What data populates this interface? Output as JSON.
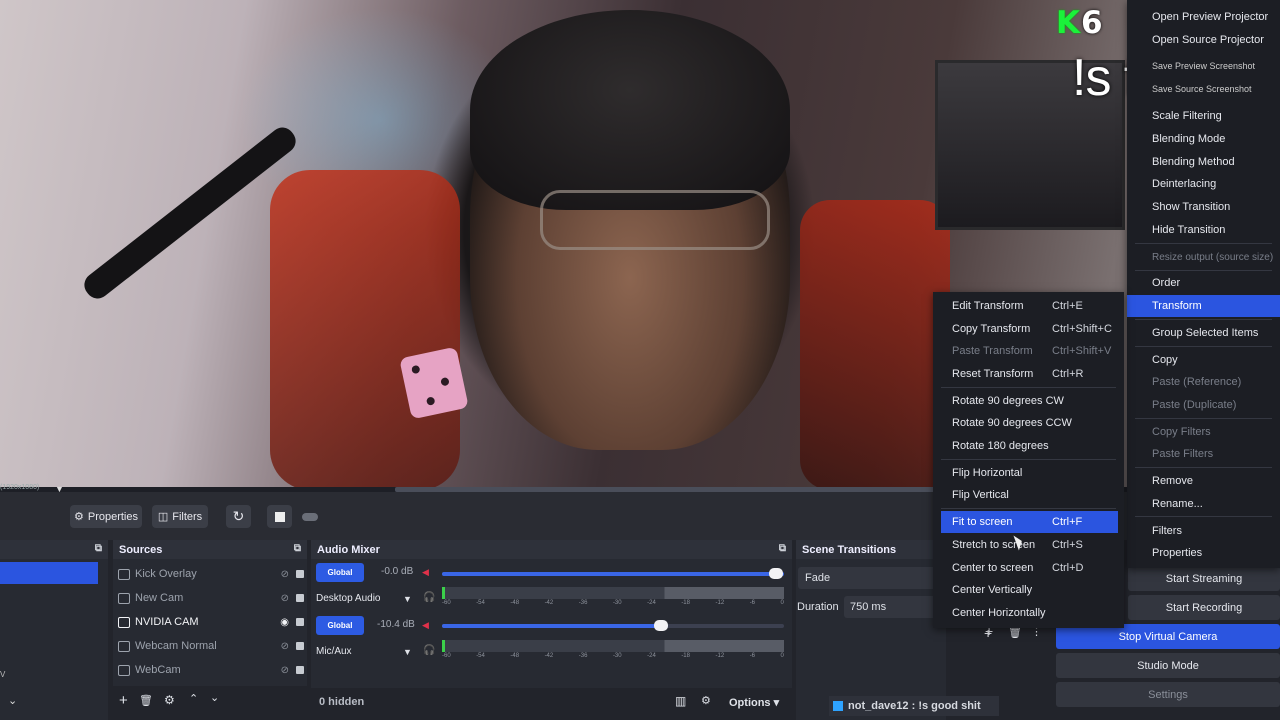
{
  "overlay": {
    "k_logo": "K",
    "k_number": "6",
    "tts_text": "!s for tts",
    "resolution": "(1920x1080)"
  },
  "toolbar": {
    "properties_label": "Properties",
    "filters_label": "Filters"
  },
  "sources": {
    "title": "Sources",
    "items": [
      {
        "label": "Kick Overlay",
        "visible": false,
        "active": false
      },
      {
        "label": "New Cam",
        "visible": false,
        "active": false
      },
      {
        "label": "NVIDIA CAM",
        "visible": true,
        "active": true
      },
      {
        "label": "Webcam Normal",
        "visible": false,
        "active": false
      },
      {
        "label": "WebCam",
        "visible": false,
        "active": false
      }
    ]
  },
  "mixer": {
    "title": "Audio Mixer",
    "global_label": "Global",
    "channels": [
      {
        "name": "Desktop Audio",
        "db": "-0.0 dB",
        "level": 1.0
      },
      {
        "name": "Mic/Aux",
        "db": "-10.4 dB",
        "level": 0.66
      }
    ],
    "scale": [
      "-60",
      "-54",
      "-48",
      "-42",
      "-36",
      "-30",
      "-24",
      "-18",
      "-12",
      "-6",
      "0"
    ],
    "hidden_label": "0 hidden",
    "options_label": "Options"
  },
  "transitions": {
    "title": "Scene Transitions",
    "selected": "Fade",
    "duration_label": "Duration",
    "duration_value": "750 ms"
  },
  "context_menu": {
    "items": [
      {
        "label": "Open Preview Projector"
      },
      {
        "label": "Open Source Projector"
      },
      {
        "label": "Save Preview Screenshot"
      },
      {
        "label": "Save Source Screenshot"
      },
      {
        "label": "Scale Filtering"
      },
      {
        "label": "Blending Mode"
      },
      {
        "label": "Blending Method"
      },
      {
        "label": "Deinterlacing"
      },
      {
        "label": "Show Transition"
      },
      {
        "label": "Hide Transition"
      },
      {
        "label": "Resize output (source size)",
        "disabled": true
      },
      {
        "label": "Order"
      },
      {
        "label": "Transform",
        "selected": true
      },
      {
        "label": "Group Selected Items"
      },
      {
        "label": "Copy"
      },
      {
        "label": "Paste (Reference)",
        "disabled": true
      },
      {
        "label": "Paste (Duplicate)",
        "disabled": true
      },
      {
        "label": "Copy Filters",
        "disabled": true
      },
      {
        "label": "Paste Filters",
        "disabled": true
      },
      {
        "label": "Remove"
      },
      {
        "label": "Rename..."
      },
      {
        "label": "Filters"
      },
      {
        "label": "Properties"
      }
    ]
  },
  "transform_menu": {
    "items": [
      {
        "label": "Edit Transform",
        "shortcut": "Ctrl+E"
      },
      {
        "label": "Copy Transform",
        "shortcut": "Ctrl+Shift+C"
      },
      {
        "label": "Paste Transform",
        "shortcut": "Ctrl+Shift+V",
        "disabled": true
      },
      {
        "label": "Reset Transform",
        "shortcut": "Ctrl+R"
      },
      {
        "label": "Rotate 90 degrees CW",
        "shortcut": ""
      },
      {
        "label": "Rotate 90 degrees CCW",
        "shortcut": ""
      },
      {
        "label": "Rotate 180 degrees",
        "shortcut": ""
      },
      {
        "label": "Flip Horizontal",
        "shortcut": ""
      },
      {
        "label": "Flip Vertical",
        "shortcut": ""
      },
      {
        "label": "Fit to screen",
        "shortcut": "Ctrl+F",
        "selected": true
      },
      {
        "label": "Stretch to screen",
        "shortcut": "Ctrl+S"
      },
      {
        "label": "Center to screen",
        "shortcut": "Ctrl+D"
      },
      {
        "label": "Center Vertically",
        "shortcut": ""
      },
      {
        "label": "Center Horizontally",
        "shortcut": ""
      }
    ]
  },
  "controls": {
    "start_streaming": "Start Streaming",
    "start_recording": "Start Recording",
    "stop_virtual_camera": "Stop Virtual Camera",
    "studio_mode": "Studio Mode",
    "settings": "Settings"
  },
  "chat": {
    "user": "not_dave12",
    "message": ": !s good shit"
  },
  "colors": {
    "accent": "#2b55e0",
    "panel": "#272a32",
    "k_green": "#1af23a"
  }
}
